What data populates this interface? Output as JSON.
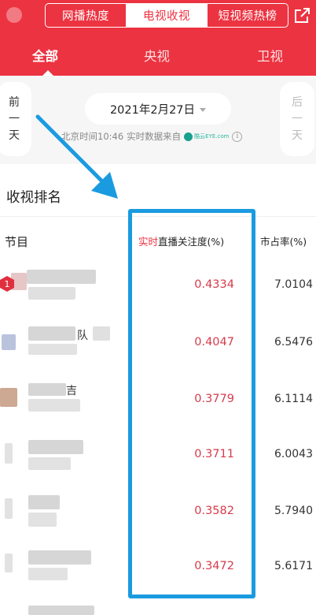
{
  "header": {
    "segments": [
      {
        "label": "网播热度",
        "active": false
      },
      {
        "label": "电视收视",
        "active": true
      },
      {
        "label": "短视频热榜",
        "active": false
      }
    ],
    "channels": [
      {
        "label": "全部",
        "active": true
      },
      {
        "label": "央视",
        "active": false
      },
      {
        "label": "卫视",
        "active": false
      }
    ],
    "accent_color": "#ec3341",
    "share_icon": "share-external-icon"
  },
  "date_nav": {
    "prev": [
      "前",
      "一",
      "天"
    ],
    "next": [
      "后",
      "一",
      "天"
    ],
    "date": "2021年2月27日",
    "time_text": "北京时间10:46",
    "source_text": "实时数据来自",
    "logo_label": "酷云EYE.com"
  },
  "ranking": {
    "title": "收视排名",
    "columns": {
      "program": "节目",
      "attention_prefix": "实时",
      "attention": "直播关注度(%)",
      "share": "市占率(%)"
    },
    "rows": [
      {
        "rank": "1",
        "name_fragment": "",
        "attention": "0.4334",
        "share": "7.0104"
      },
      {
        "rank": "",
        "name_fragment": "队",
        "attention": "0.4047",
        "share": "6.5476"
      },
      {
        "rank": "",
        "name_fragment": "吉",
        "attention": "0.3779",
        "share": "6.1114"
      },
      {
        "rank": "",
        "name_fragment": "",
        "attention": "0.3711",
        "share": "6.0043"
      },
      {
        "rank": "",
        "name_fragment": "",
        "attention": "0.3582",
        "share": "5.7940"
      },
      {
        "rank": "",
        "name_fragment": "",
        "attention": "0.3472",
        "share": "5.6171"
      }
    ]
  },
  "annotation": {
    "highlight_color": "#1a9be0"
  }
}
